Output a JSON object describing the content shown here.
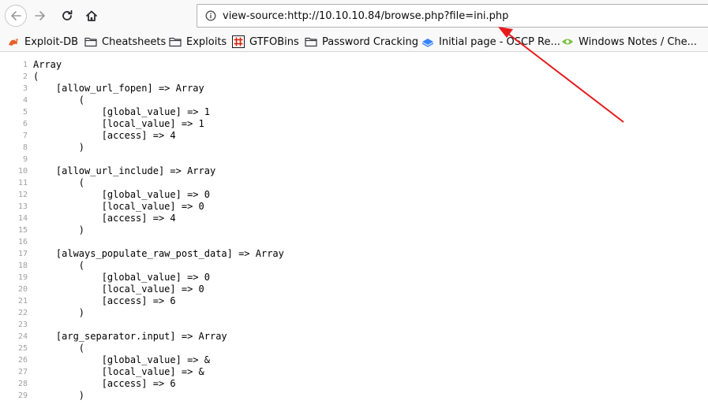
{
  "toolbar": {
    "url": "view-source:http://10.10.10.84/browse.php?file=ini.php"
  },
  "bookmarks": [
    {
      "label": "Exploit-DB",
      "icon": "exploit-db-icon"
    },
    {
      "label": "Cheatsheets",
      "icon": "folder-icon"
    },
    {
      "label": "Exploits",
      "icon": "folder-icon"
    },
    {
      "label": "GTFOBins",
      "icon": "gtfobins-icon"
    },
    {
      "label": "Password Cracking",
      "icon": "folder-icon"
    },
    {
      "label": "Initial page - OSCP Re...",
      "icon": "gitbook-icon"
    },
    {
      "label": "Windows Notes / Che...",
      "icon": "windows-notes-icon"
    }
  ],
  "source_lines": [
    {
      "n": "1",
      "text": "Array"
    },
    {
      "n": "2",
      "text": "("
    },
    {
      "n": "3",
      "text": "    [allow_url_fopen] => Array"
    },
    {
      "n": "4",
      "text": "        ("
    },
    {
      "n": "5",
      "text": "            [global_value] => 1"
    },
    {
      "n": "6",
      "text": "            [local_value] => 1"
    },
    {
      "n": "7",
      "text": "            [access] => 4"
    },
    {
      "n": "8",
      "text": "        )"
    },
    {
      "n": "9",
      "text": ""
    },
    {
      "n": "10",
      "text": "    [allow_url_include] => Array"
    },
    {
      "n": "11",
      "text": "        ("
    },
    {
      "n": "12",
      "text": "            [global_value] => 0"
    },
    {
      "n": "13",
      "text": "            [local_value] => 0"
    },
    {
      "n": "14",
      "text": "            [access] => 4"
    },
    {
      "n": "15",
      "text": "        )"
    },
    {
      "n": "16",
      "text": ""
    },
    {
      "n": "17",
      "text": "    [always_populate_raw_post_data] => Array"
    },
    {
      "n": "18",
      "text": "        ("
    },
    {
      "n": "19",
      "text": "            [global_value] => 0"
    },
    {
      "n": "20",
      "text": "            [local_value] => 0"
    },
    {
      "n": "21",
      "text": "            [access] => 6"
    },
    {
      "n": "22",
      "text": "        )"
    },
    {
      "n": "23",
      "text": ""
    },
    {
      "n": "24",
      "text": "    [arg_separator.input] => Array"
    },
    {
      "n": "25",
      "text": "        ("
    },
    {
      "n": "26",
      "text": "            [global_value] => &"
    },
    {
      "n": "27",
      "text": "            [local_value] => &"
    },
    {
      "n": "28",
      "text": "            [access] => 6"
    },
    {
      "n": "29",
      "text": "        )"
    }
  ],
  "colors": {
    "annotation_arrow": "#e8191b",
    "line_number": "#a0a0a0"
  }
}
